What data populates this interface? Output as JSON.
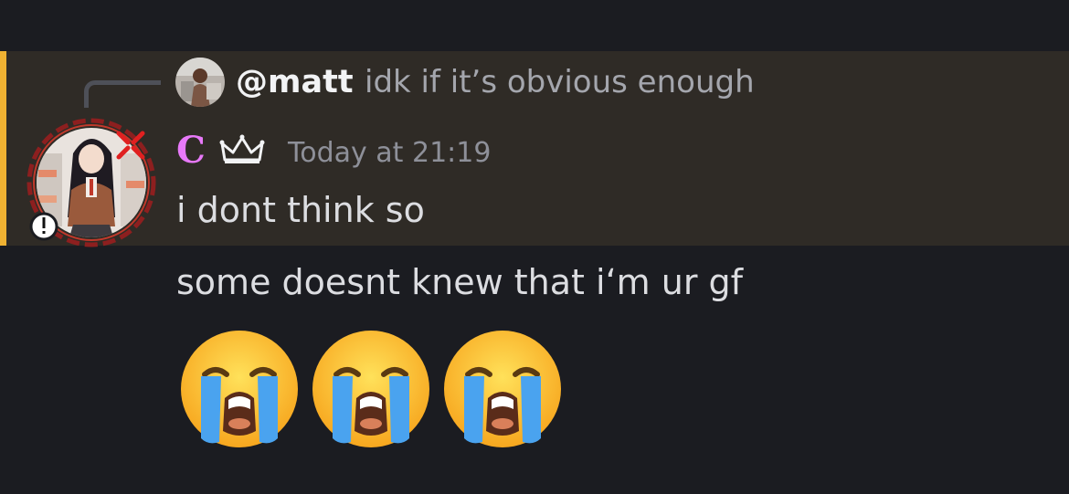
{
  "reply": {
    "mention": "@matt",
    "text": "idk if it’s obvious enough"
  },
  "message": {
    "author": "C",
    "badge_icon": "crown-icon",
    "timestamp": "Today at 21:19",
    "lines": [
      "i dont think so",
      "some doesnt knew that i‘m ur gf"
    ],
    "emoji": [
      "loudly-crying-face",
      "loudly-crying-face",
      "loudly-crying-face"
    ]
  },
  "colors": {
    "background": "#1b1c21",
    "highlight": "#2f2b26",
    "highlight_bar": "#f0b232",
    "username": "#e879f9",
    "text": "#dcdde1",
    "muted": "#a4a6ad"
  }
}
